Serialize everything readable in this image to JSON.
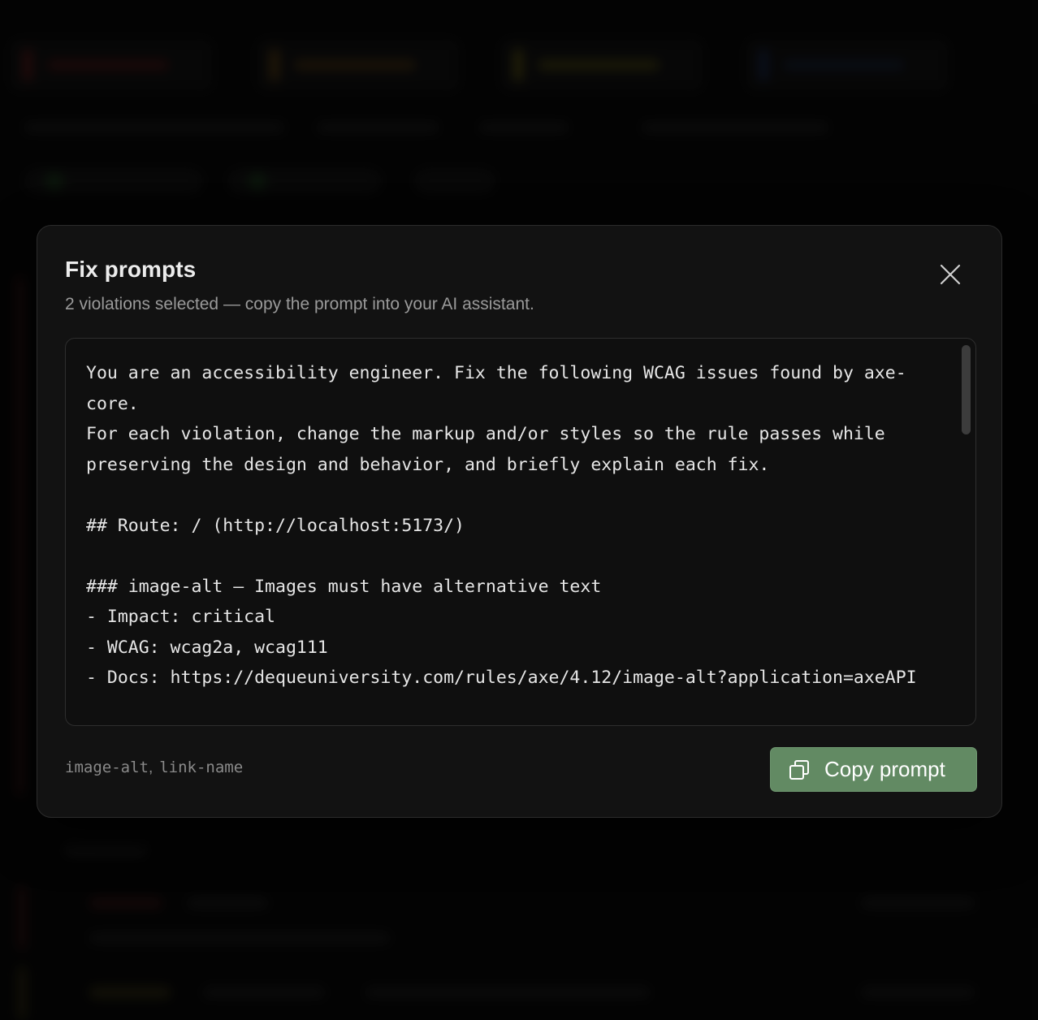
{
  "modal": {
    "title": "Fix prompts",
    "subtitle": "2 violations selected — copy the prompt into your AI assistant.",
    "prompt": "You are an accessibility engineer. Fix the following WCAG issues found by axe-core.\nFor each violation, change the markup and/or styles so the rule passes while preserving the design and behavior, and briefly explain each fix.\n\n## Route: / (http://localhost:5173/)\n\n### image-alt — Images must have alternative text\n- Impact: critical\n- WCAG: wcag2a, wcag111\n- Docs: https://dequeuniversity.com/rules/axe/4.12/image-alt?application=axeAPI",
    "selected_rules": [
      "image-alt",
      "link-name"
    ],
    "copy_button_label": "Copy prompt",
    "close_icon": "close-icon",
    "copy_icon": "copy-icon"
  },
  "colors": {
    "accent": "#628a63",
    "modal_bg": "#121212",
    "overlay": "#070707"
  }
}
